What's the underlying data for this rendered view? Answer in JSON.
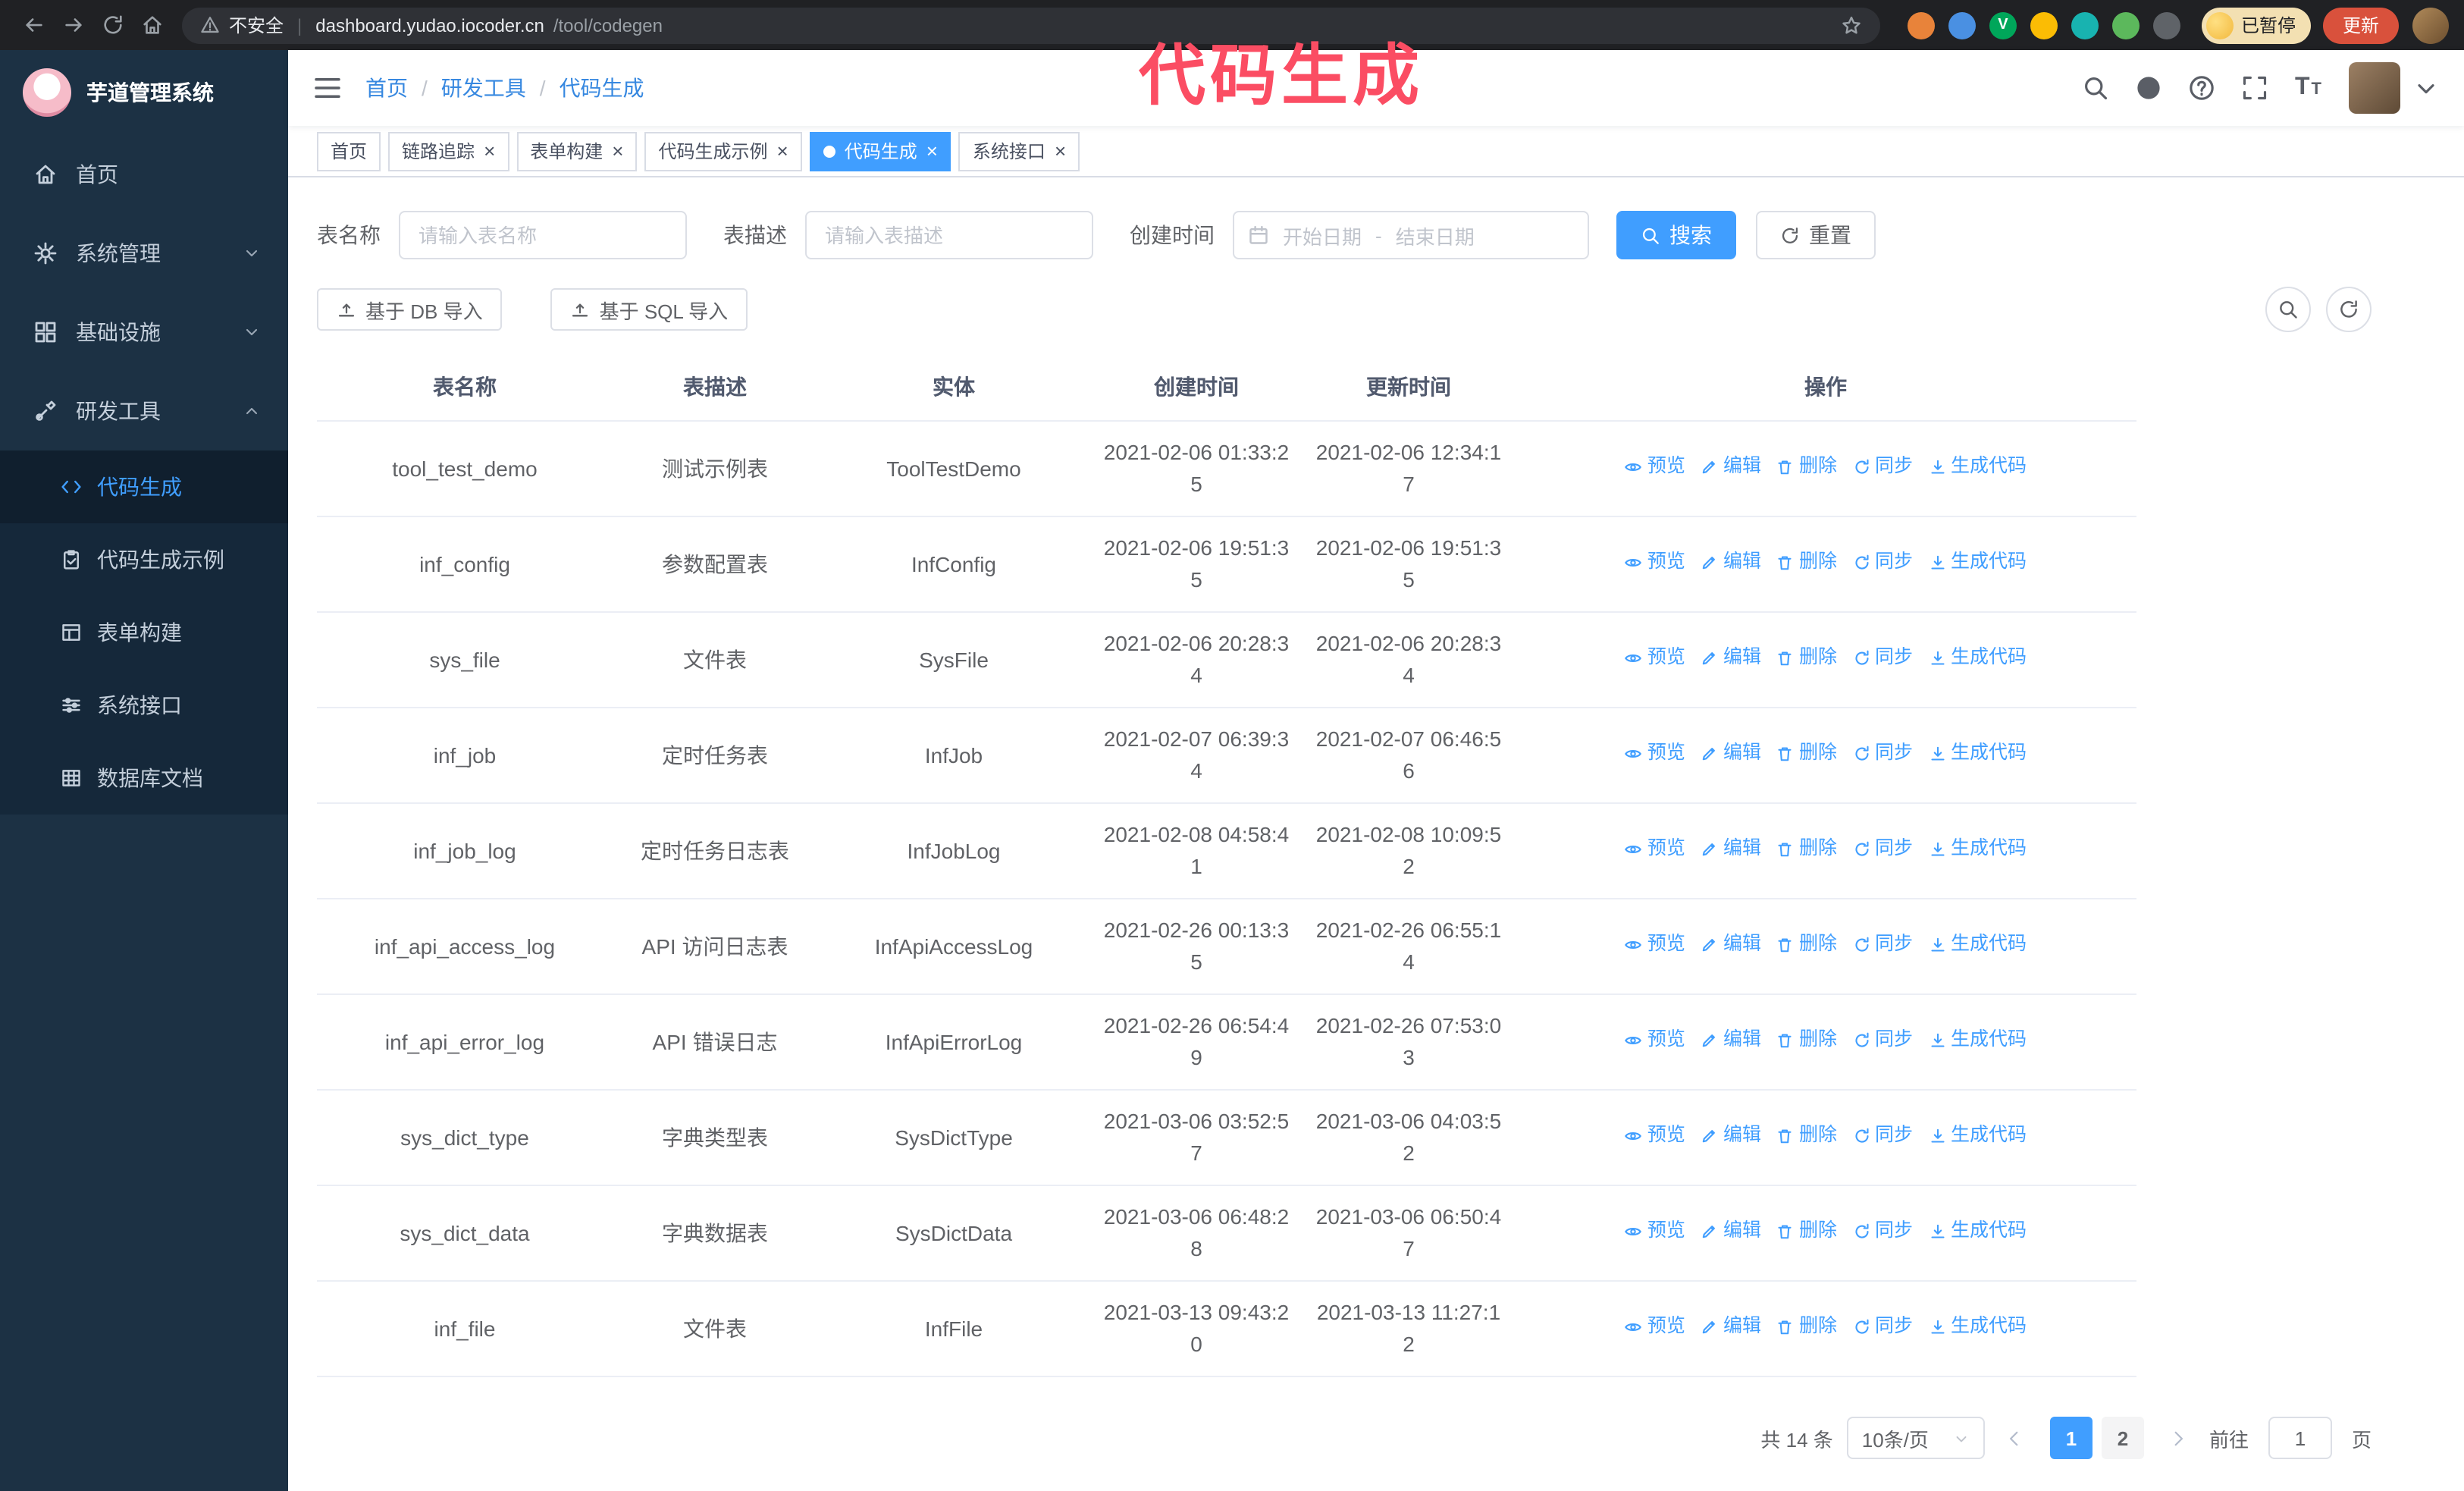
{
  "browser": {
    "nav_icons": [
      "back-icon",
      "forward-icon",
      "reload-icon",
      "home-icon"
    ],
    "security_label": "不安全",
    "url_divider": "|",
    "url_domain": "dashboard.yudao.iocoder.cn",
    "url_path": "/tool/codegen",
    "paused_label": "已暂停",
    "update_label": "更新",
    "extensions": [
      {
        "color": "#e8833a",
        "letter": ""
      },
      {
        "color": "#4a90e2",
        "letter": ""
      },
      {
        "color": "#00a65a",
        "letter": "V"
      },
      {
        "color": "#fbbc04",
        "letter": ""
      },
      {
        "color": "#18b3b0",
        "letter": ""
      },
      {
        "color": "#5cb85c",
        "letter": ""
      },
      {
        "color": "#5f6368",
        "letter": ""
      }
    ]
  },
  "overlay": {
    "title": "代码生成"
  },
  "sidebar": {
    "title": "芋道管理系统",
    "menu": [
      {
        "id": "home",
        "label": "首页",
        "icon": "home-icon"
      },
      {
        "id": "system",
        "label": "系统管理",
        "icon": "gear-icon",
        "chevron": "down"
      },
      {
        "id": "infra",
        "label": "基础设施",
        "icon": "grid-icon",
        "chevron": "down"
      },
      {
        "id": "devtools",
        "label": "研发工具",
        "icon": "tools-icon",
        "chevron": "up",
        "children": [
          {
            "id": "codegen",
            "label": "代码生成",
            "icon": "code-icon",
            "active": true
          },
          {
            "id": "codegen-example",
            "label": "代码生成示例",
            "icon": "clipboard-check-icon"
          },
          {
            "id": "form-builder",
            "label": "表单构建",
            "icon": "form-icon"
          },
          {
            "id": "system-api",
            "label": "系统接口",
            "icon": "sliders-icon"
          },
          {
            "id": "db-doc",
            "label": "数据库文档",
            "icon": "table-grid-icon"
          }
        ]
      }
    ]
  },
  "header": {
    "breadcrumb": [
      "首页",
      "研发工具",
      "代码生成"
    ],
    "breadcrumb_separator": "/",
    "icons": [
      "search-icon",
      "github-icon",
      "help-icon",
      "fullscreen-icon"
    ]
  },
  "tags": [
    {
      "id": "home",
      "label": "首页",
      "closable": false,
      "active": false
    },
    {
      "id": "trace",
      "label": "链路追踪",
      "closable": true,
      "active": false
    },
    {
      "id": "form-builder",
      "label": "表单构建",
      "closable": true,
      "active": false
    },
    {
      "id": "codegen-example",
      "label": "代码生成示例",
      "closable": true,
      "active": false
    },
    {
      "id": "codegen",
      "label": "代码生成",
      "closable": true,
      "active": true
    },
    {
      "id": "system-api",
      "label": "系统接口",
      "closable": true,
      "active": false
    }
  ],
  "filters": {
    "table_name_label": "表名称",
    "table_name_placeholder": "请输入表名称",
    "table_desc_label": "表描述",
    "table_desc_placeholder": "请输入表描述",
    "create_time_label": "创建时间",
    "start_date_placeholder": "开始日期",
    "date_separator": "-",
    "end_date_placeholder": "结束日期",
    "search_label": "搜索",
    "reset_label": "重置"
  },
  "toolbar": {
    "import_db_label": "基于 DB 导入",
    "import_sql_label": "基于 SQL 导入"
  },
  "table": {
    "columns": [
      "表名称",
      "表描述",
      "实体",
      "创建时间",
      "更新时间",
      "操作"
    ],
    "row_actions": [
      {
        "id": "preview",
        "label": "预览",
        "icon": "eye-icon"
      },
      {
        "id": "edit",
        "label": "编辑",
        "icon": "edit-icon"
      },
      {
        "id": "delete",
        "label": "删除",
        "icon": "delete-icon"
      },
      {
        "id": "sync",
        "label": "同步",
        "icon": "sync-icon"
      },
      {
        "id": "generate",
        "label": "生成代码",
        "icon": "gen-code-icon"
      }
    ],
    "rows": [
      {
        "name": "tool_test_demo",
        "desc": "测试示例表",
        "entity": "ToolTestDemo",
        "created": "2021-02-06 01:33:25",
        "updated": "2021-02-06 12:34:17"
      },
      {
        "name": "inf_config",
        "desc": "参数配置表",
        "entity": "InfConfig",
        "created": "2021-02-06 19:51:35",
        "updated": "2021-02-06 19:51:35"
      },
      {
        "name": "sys_file",
        "desc": "文件表",
        "entity": "SysFile",
        "created": "2021-02-06 20:28:34",
        "updated": "2021-02-06 20:28:34"
      },
      {
        "name": "inf_job",
        "desc": "定时任务表",
        "entity": "InfJob",
        "created": "2021-02-07 06:39:34",
        "updated": "2021-02-07 06:46:56"
      },
      {
        "name": "inf_job_log",
        "desc": "定时任务日志表",
        "entity": "InfJobLog",
        "created": "2021-02-08 04:58:41",
        "updated": "2021-02-08 10:09:52"
      },
      {
        "name": "inf_api_access_log",
        "desc": "API 访问日志表",
        "entity": "InfApiAccessLog",
        "created": "2021-02-26 00:13:35",
        "updated": "2021-02-26 06:55:14"
      },
      {
        "name": "inf_api_error_log",
        "desc": "API 错误日志",
        "entity": "InfApiErrorLog",
        "created": "2021-02-26 06:54:49",
        "updated": "2021-02-26 07:53:03"
      },
      {
        "name": "sys_dict_type",
        "desc": "字典类型表",
        "entity": "SysDictType",
        "created": "2021-03-06 03:52:57",
        "updated": "2021-03-06 04:03:52"
      },
      {
        "name": "sys_dict_data",
        "desc": "字典数据表",
        "entity": "SysDictData",
        "created": "2021-03-06 06:48:28",
        "updated": "2021-03-06 06:50:47"
      },
      {
        "name": "inf_file",
        "desc": "文件表",
        "entity": "InfFile",
        "created": "2021-03-13 09:43:20",
        "updated": "2021-03-13 11:27:12"
      }
    ]
  },
  "pagination": {
    "total_label": "共 14 条",
    "page_size": "10条/页",
    "pages": [
      "1",
      "2"
    ],
    "active_page": "1",
    "goto_label": "前往",
    "goto_value": "1",
    "goto_suffix": "页"
  },
  "colors": {
    "accent": "#409eff",
    "overlay_pink": "#fb4d63",
    "sidebar_bg": "#1c3144",
    "submenu_bg": "#15283a",
    "chrome_bg": "#202124",
    "update_button": "#d9513c"
  }
}
